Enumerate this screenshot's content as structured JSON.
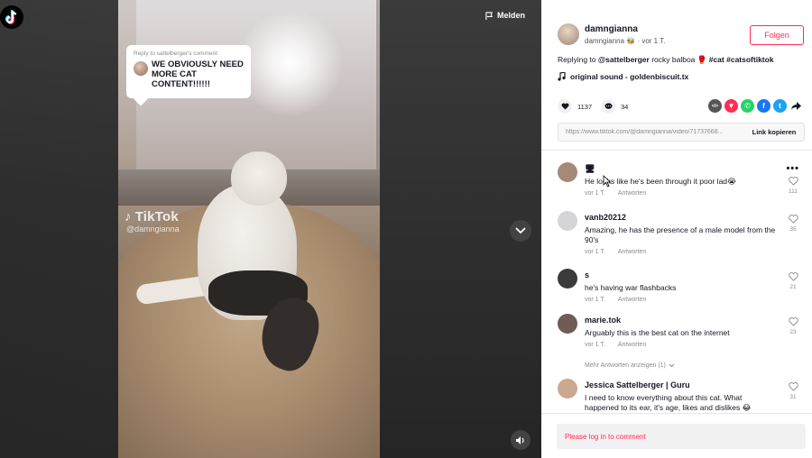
{
  "video": {
    "report_label": "Melden",
    "reply_bubble": {
      "header": "Reply to sattelberger's comment",
      "text": "WE OBVIOUSLY NEED MORE CAT CONTENT!!!!!!"
    },
    "watermark_brand": "TikTok",
    "watermark_user": "@damngianna"
  },
  "author": {
    "username": "damngianna",
    "meta": "damngianna 🐝 · vor 1 T.",
    "follow_label": "Folgen"
  },
  "caption": {
    "prefix": "Replying to ",
    "mention": "@sattelberger",
    "middle": " rocky balboa 🥊 ",
    "hashtag_cat": "#cat",
    "hashtag_cats": "#catsoftiktok"
  },
  "music": {
    "label": "original sound - goldenbiscuit.tx"
  },
  "stats": {
    "likes": "1137",
    "comments": "34"
  },
  "share_icons": [
    {
      "name": "embed-icon",
      "glyph": "</>",
      "color": "#555555"
    },
    {
      "name": "send-icon",
      "glyph": "▼",
      "color": "#fe2c55"
    },
    {
      "name": "whatsapp-icon",
      "glyph": "✆",
      "color": "#25d366"
    },
    {
      "name": "facebook-icon",
      "glyph": "f",
      "color": "#1877f2"
    },
    {
      "name": "twitter-icon",
      "glyph": "t",
      "color": "#1da1f2"
    }
  ],
  "link": {
    "url": "https://www.tiktok.com/@damngianna/video/71737668...",
    "copy_label": "Link kopieren"
  },
  "comments": [
    {
      "user": "🖥",
      "text": "He looks like he's been through it poor lad😭",
      "date": "vor 1 T.",
      "reply": "Antworten",
      "likes": "111",
      "avatar_color": "#a58a78"
    },
    {
      "user": "vanb20212",
      "text": "Amazing, he has the presence of a male model from the 90's",
      "date": "vor 1 T.",
      "reply": "Antworten",
      "likes": "35",
      "avatar_color": "#d5d5d7"
    },
    {
      "user": "s",
      "text": "he's having war flashbacks",
      "date": "vor 1 T.",
      "reply": "Antworten",
      "likes": "21",
      "avatar_color": "#3b3b3b"
    },
    {
      "user": "marie.tok",
      "text": "Arguably this is the best cat on the internet",
      "date": "vor 1 T.",
      "reply": "Antworten",
      "likes": "23",
      "avatar_color": "#6e5c55"
    },
    {
      "user": "Jessica Sattelberger | Guru",
      "text": "I need to know everything about this cat. What happened to its ear, it's age, likes and dislikes 😂",
      "date": "",
      "reply": "",
      "likes": "31",
      "avatar_color": "#c9a98f"
    }
  ],
  "more_replies": "Mehr Antworten anzeigen (1)",
  "login_prompt": "Please log in to comment"
}
